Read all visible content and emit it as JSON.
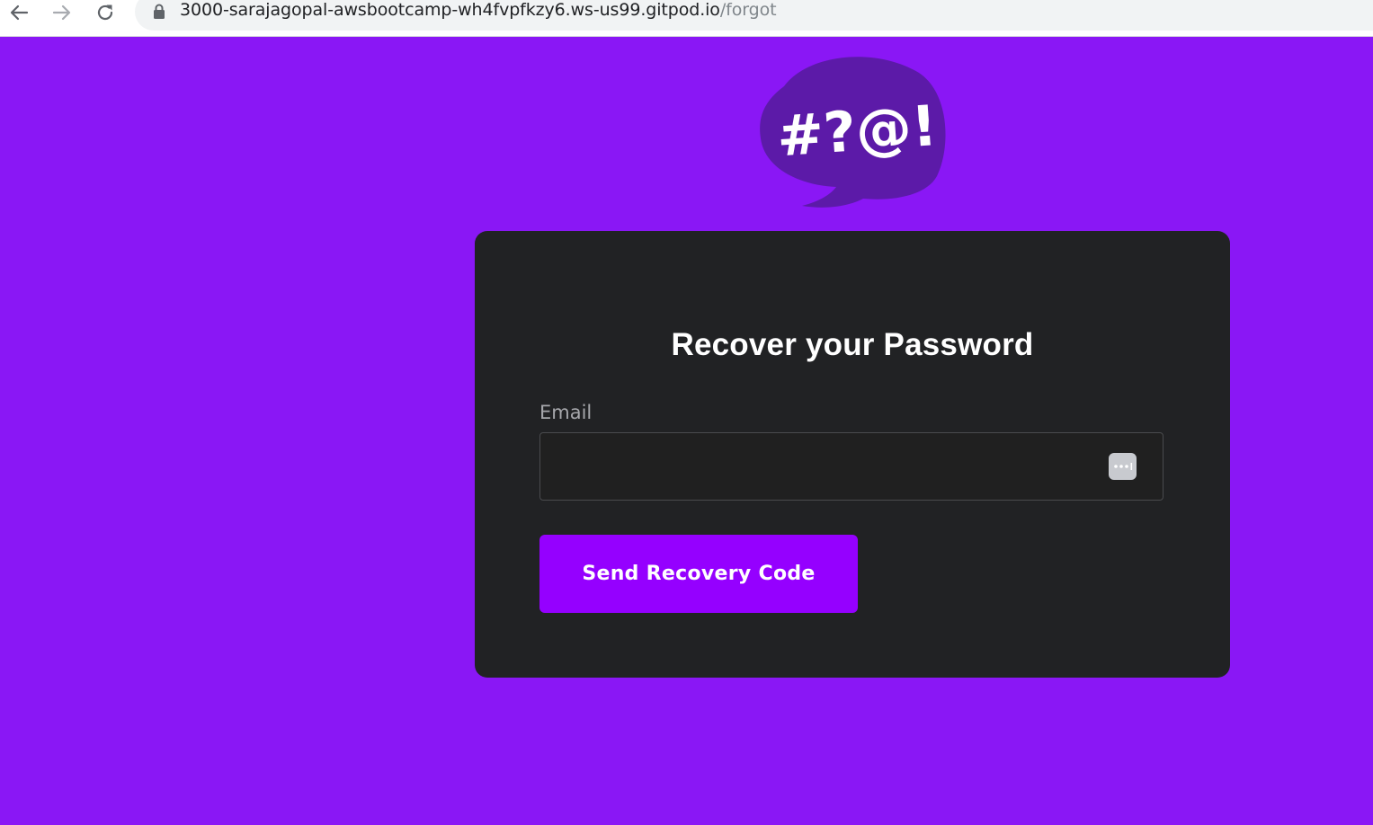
{
  "browser": {
    "url_host": "3000-sarajagopal-awsbootcamp-wh4fvpfkzy6.ws-us99.gitpod.io",
    "url_path": "/forgot"
  },
  "logo": {
    "text": "#?@!",
    "colors": {
      "bubble": "#5c1aa8",
      "text": "#ffffff"
    }
  },
  "recover": {
    "title": "Recover your Password",
    "email_label": "Email",
    "email_value": "",
    "button_label": "Send Recovery Code"
  },
  "colors": {
    "background": "#8a17f5",
    "card": "#212224",
    "button": "#9500ff"
  },
  "icons": [
    "back-arrow-icon",
    "forward-arrow-icon",
    "reload-icon",
    "lock-icon",
    "autofill-menu-icon"
  ]
}
